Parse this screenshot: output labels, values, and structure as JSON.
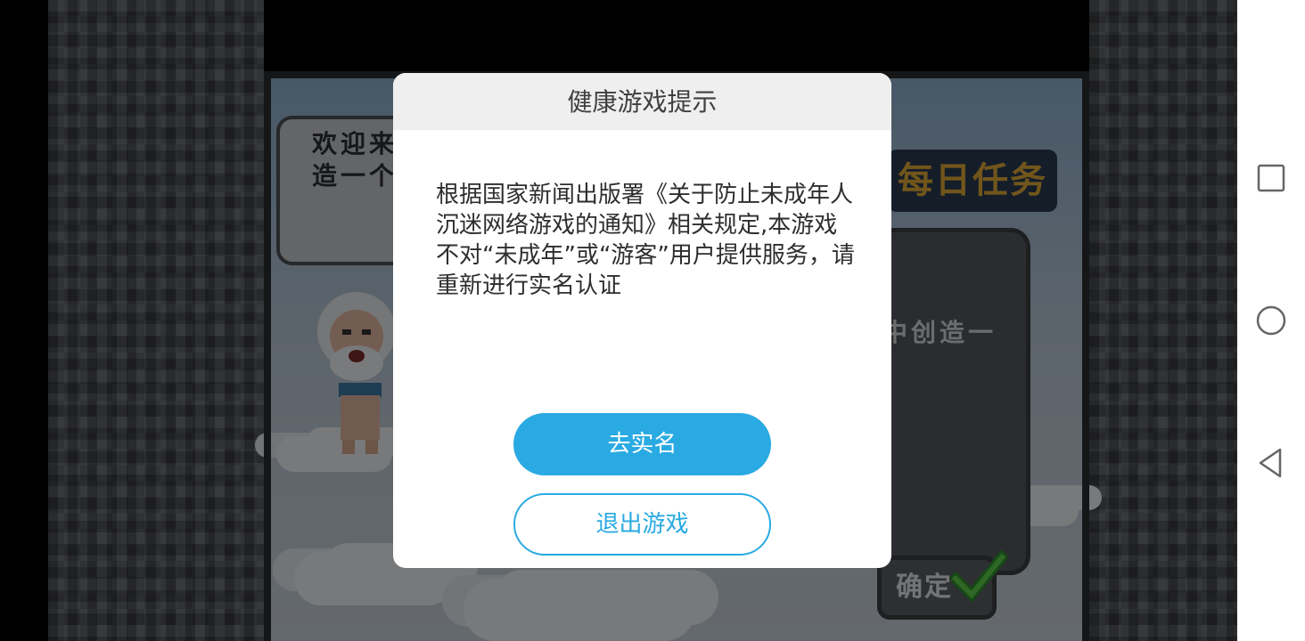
{
  "game": {
    "speech_text": "欢迎来\n造一个",
    "daily_task_title": "每日任务",
    "task_text": "中创造一",
    "confirm_label": "确定"
  },
  "dialog": {
    "title": "健康游戏提示",
    "message": "根据国家新闻出版署《关于防止未成年人沉迷网络游戏的通知》相关规定,本游戏不对“未成年”或“游客”用户提供服务，请重新进行实名认证",
    "primary_button": "去实名",
    "secondary_button": "退出游戏"
  },
  "nav_bar": {
    "icons": [
      "recent-apps-icon",
      "home-icon",
      "back-icon"
    ]
  },
  "colors": {
    "accent": "#2aaae2",
    "dialog_header_bg": "#efefef",
    "overlay": "rgba(0,0,0,0.5)"
  }
}
